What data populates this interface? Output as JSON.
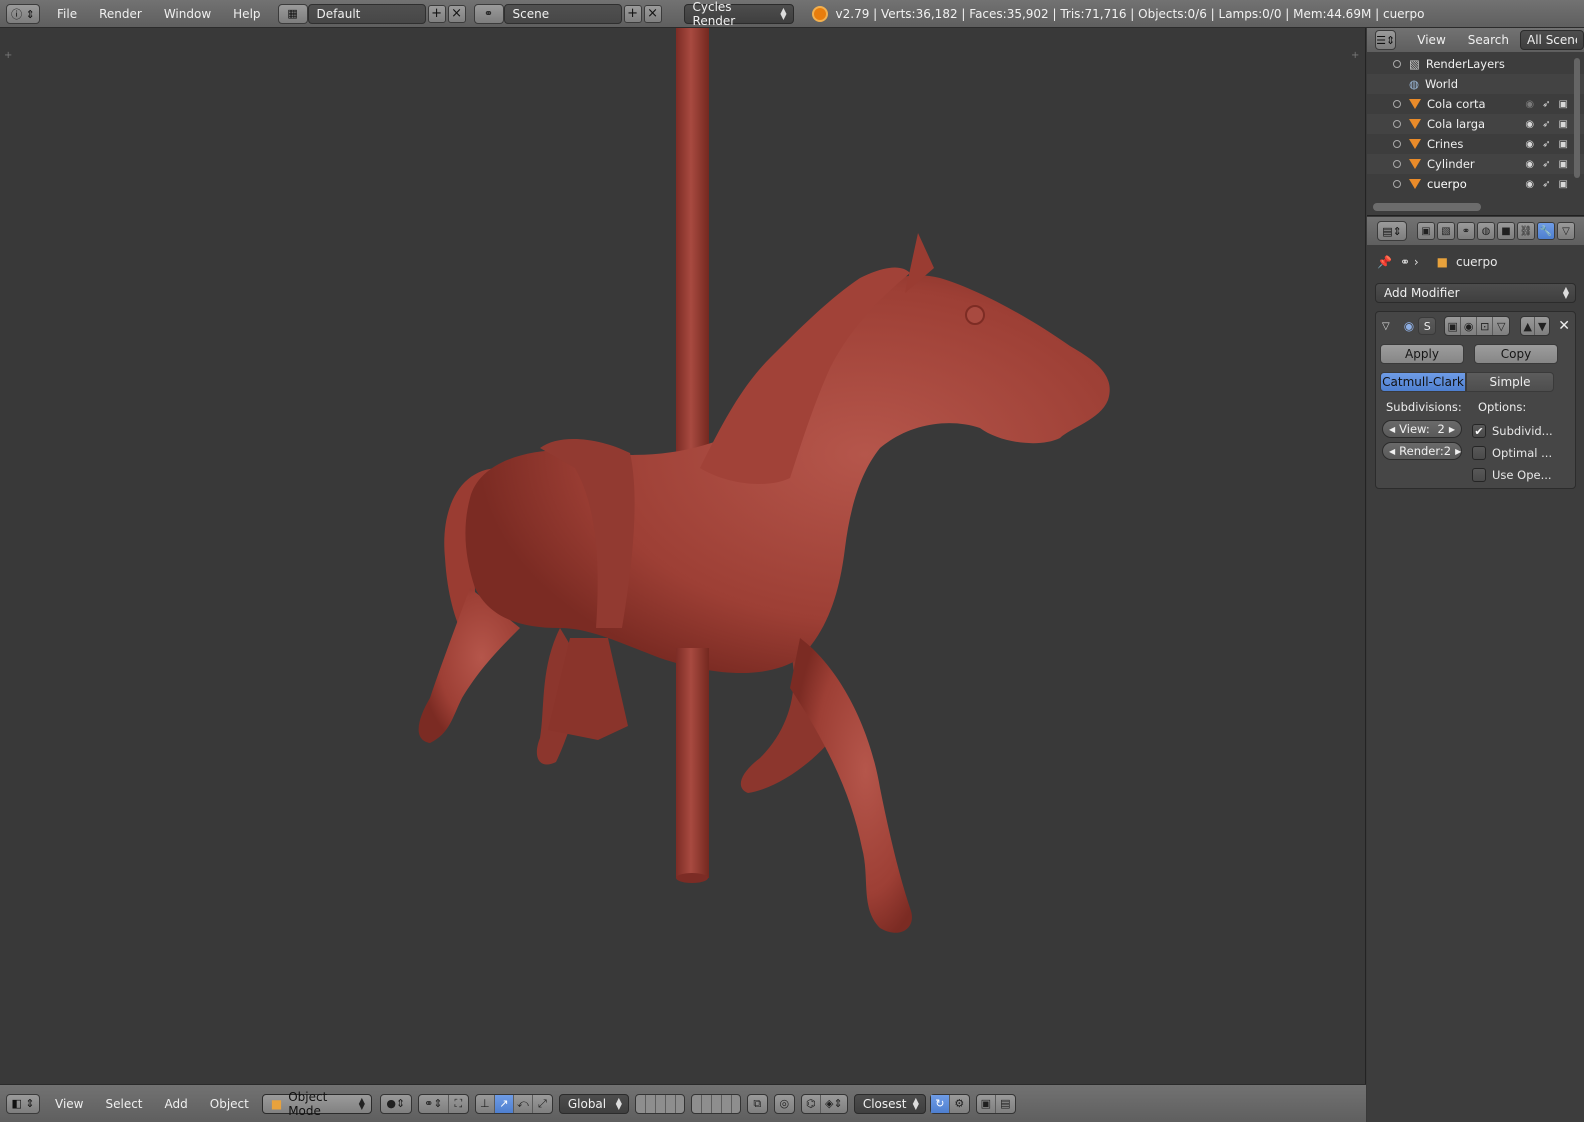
{
  "topbar": {
    "menus": [
      "File",
      "Render",
      "Window",
      "Help"
    ],
    "layout_name": "Default",
    "scene_name": "Scene",
    "render_engine": "Cycles Render",
    "stats": "v2.79 | Verts:36,182 | Faces:35,902 | Tris:71,716 | Objects:0/6 | Lamps:0/0 | Mem:44.69M | cuerpo"
  },
  "outliner": {
    "menus": [
      "View",
      "Search"
    ],
    "filter": "All Scenes",
    "items": [
      {
        "label": "RenderLayers",
        "kind": "renderlayers"
      },
      {
        "label": "World",
        "kind": "world"
      },
      {
        "label": "Cola corta",
        "kind": "mesh"
      },
      {
        "label": "Cola larga",
        "kind": "mesh"
      },
      {
        "label": "Crines",
        "kind": "mesh"
      },
      {
        "label": "Cylinder",
        "kind": "mesh"
      },
      {
        "label": "cuerpo",
        "kind": "mesh"
      }
    ]
  },
  "properties": {
    "object_name": "cuerpo",
    "add_modifier_label": "Add Modifier",
    "modifier": {
      "short_name": "S",
      "apply_label": "Apply",
      "copy_label": "Copy",
      "mode_catmull": "Catmull-Clark",
      "mode_simple": "Simple",
      "subdivisions_label": "Subdivisions:",
      "options_label": "Options:",
      "view_label": "View:",
      "view_value": "2",
      "render_label": "Render:",
      "render_value": "2",
      "options": [
        {
          "label": "Subdivid...",
          "checked": true
        },
        {
          "label": "Optimal ...",
          "checked": false
        },
        {
          "label": "Use Ope...",
          "checked": false
        }
      ]
    }
  },
  "bottombar": {
    "menus": [
      "View",
      "Select",
      "Add",
      "Object"
    ],
    "mode": "Object Mode",
    "orientation": "Global",
    "snap_target": "Closest"
  },
  "colors": {
    "model": "#a8453a",
    "accent": "#5680c2",
    "viewport_bg": "#393939"
  }
}
